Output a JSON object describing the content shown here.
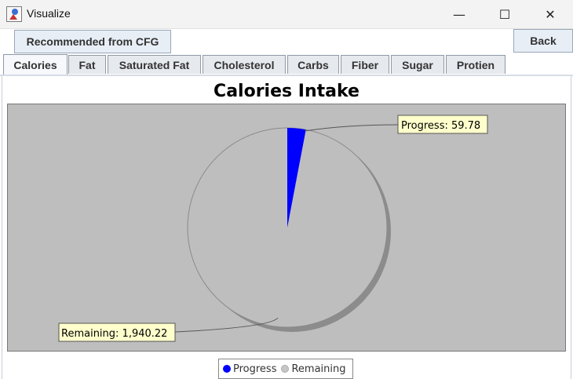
{
  "window": {
    "title": "Visualize",
    "minimize_glyph": "—",
    "maximize_glyph": "☐",
    "close_glyph": "✕"
  },
  "toolbar": {
    "recommended_label": "Recommended from CFG",
    "back_label": "Back"
  },
  "tabs": [
    {
      "label": "Calories",
      "active": true
    },
    {
      "label": "Fat",
      "active": false
    },
    {
      "label": "Saturated Fat",
      "active": false
    },
    {
      "label": "Cholesterol",
      "active": false
    },
    {
      "label": "Carbs",
      "active": false
    },
    {
      "label": "Fiber",
      "active": false
    },
    {
      "label": "Sugar",
      "active": false
    },
    {
      "label": "Protien",
      "active": false
    }
  ],
  "chart_data": {
    "type": "pie",
    "title": "Calories Intake",
    "slices": [
      {
        "name": "Progress",
        "value": 59.78,
        "color": "#0000ff",
        "label": "Progress: 59.78"
      },
      {
        "name": "Remaining",
        "value": 1940.22,
        "color": "#bebebe",
        "label": "Remaining: 1,940.22"
      }
    ],
    "legend": {
      "placement": "bottom"
    }
  },
  "colors": {
    "plot_background": "#bebebe",
    "label_background": "#ffffcc"
  }
}
